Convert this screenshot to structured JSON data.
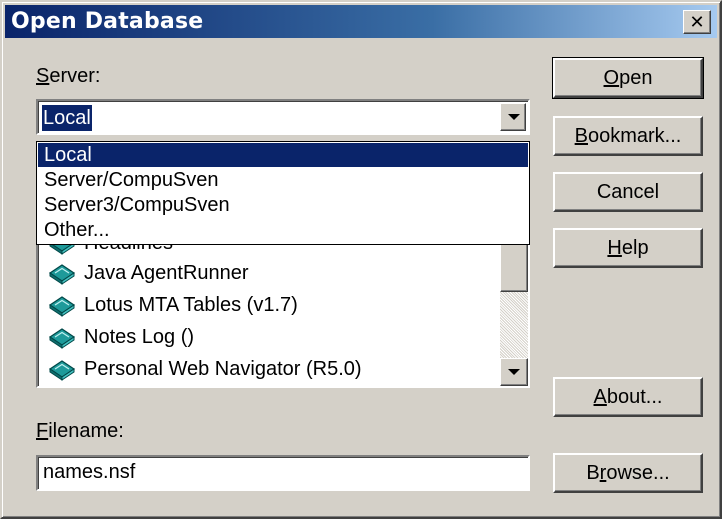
{
  "window": {
    "title": "Open Database",
    "close_glyph": "✕"
  },
  "server": {
    "label": "Server:",
    "label_underline": "S",
    "label_rest": "erver:",
    "value": "Local",
    "options": [
      "Local",
      "Server/CompuSven",
      "Server3/CompuSven",
      "Other..."
    ],
    "selected_index": 0
  },
  "database_list": {
    "partial_item": "Headlines",
    "items": [
      "Java AgentRunner",
      "Lotus MTA Tables (v1.7)",
      "Notes Log ()",
      "Personal Web Navigator (R5.0)"
    ],
    "icon": "database-icon"
  },
  "filename": {
    "label_underline": "F",
    "label_rest": "ilename:",
    "value": "names.nsf"
  },
  "buttons": {
    "open": {
      "u": "O",
      "rest": "pen"
    },
    "bookmark": {
      "u": "B",
      "rest": "ookmark..."
    },
    "cancel": {
      "label": "Cancel"
    },
    "help": {
      "u": "H",
      "rest": "elp"
    },
    "about": {
      "u": "A",
      "rest": "bout..."
    },
    "browse": {
      "pre": "B",
      "u": "r",
      "rest": "owse..."
    }
  },
  "colors": {
    "selection": "#0a246a",
    "face": "#d4d0c8",
    "icon_teal": "#1e9a9a"
  }
}
